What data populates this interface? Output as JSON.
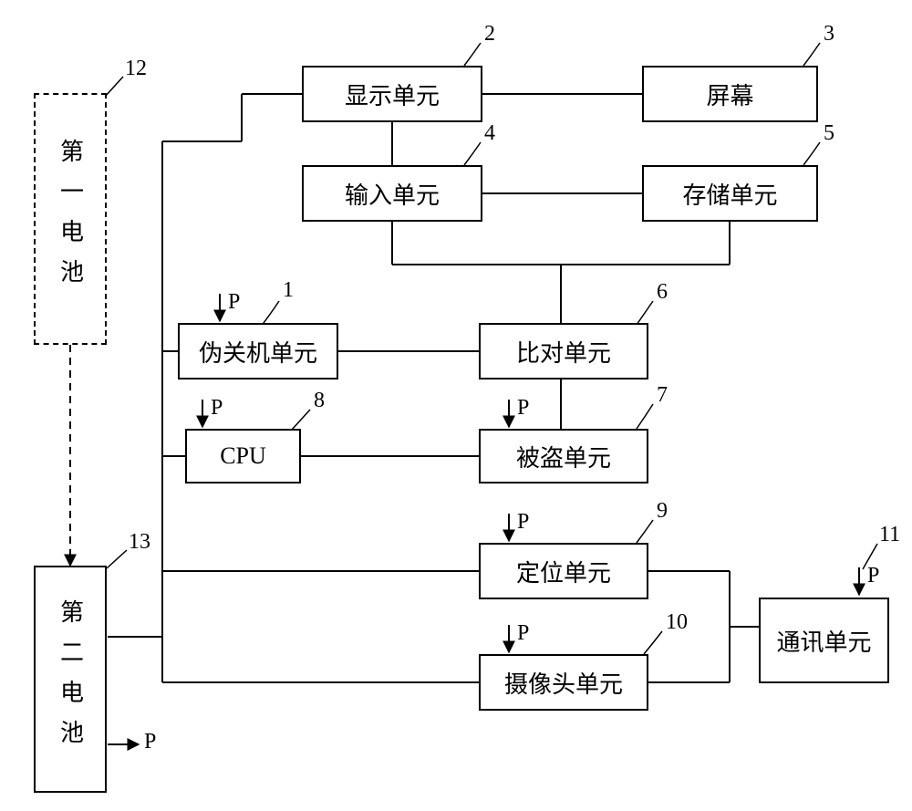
{
  "blocks": {
    "battery1": "第一电池",
    "battery2": "第二电池",
    "display_unit": "显示单元",
    "screen": "屏幕",
    "input_unit": "输入单元",
    "storage_unit": "存储单元",
    "fake_shutdown_unit": "伪关机单元",
    "compare_unit": "比对单元",
    "cpu": "CPU",
    "stolen_unit": "被盗单元",
    "positioning_unit": "定位单元",
    "camera_unit": "摄像头单元",
    "comm_unit": "通讯单元"
  },
  "numbers": {
    "n1": "1",
    "n2": "2",
    "n3": "3",
    "n4": "4",
    "n5": "5",
    "n6": "6",
    "n7": "7",
    "n8": "8",
    "n9": "9",
    "n10": "10",
    "n11": "11",
    "n12": "12",
    "n13": "13"
  },
  "p_label": "P"
}
